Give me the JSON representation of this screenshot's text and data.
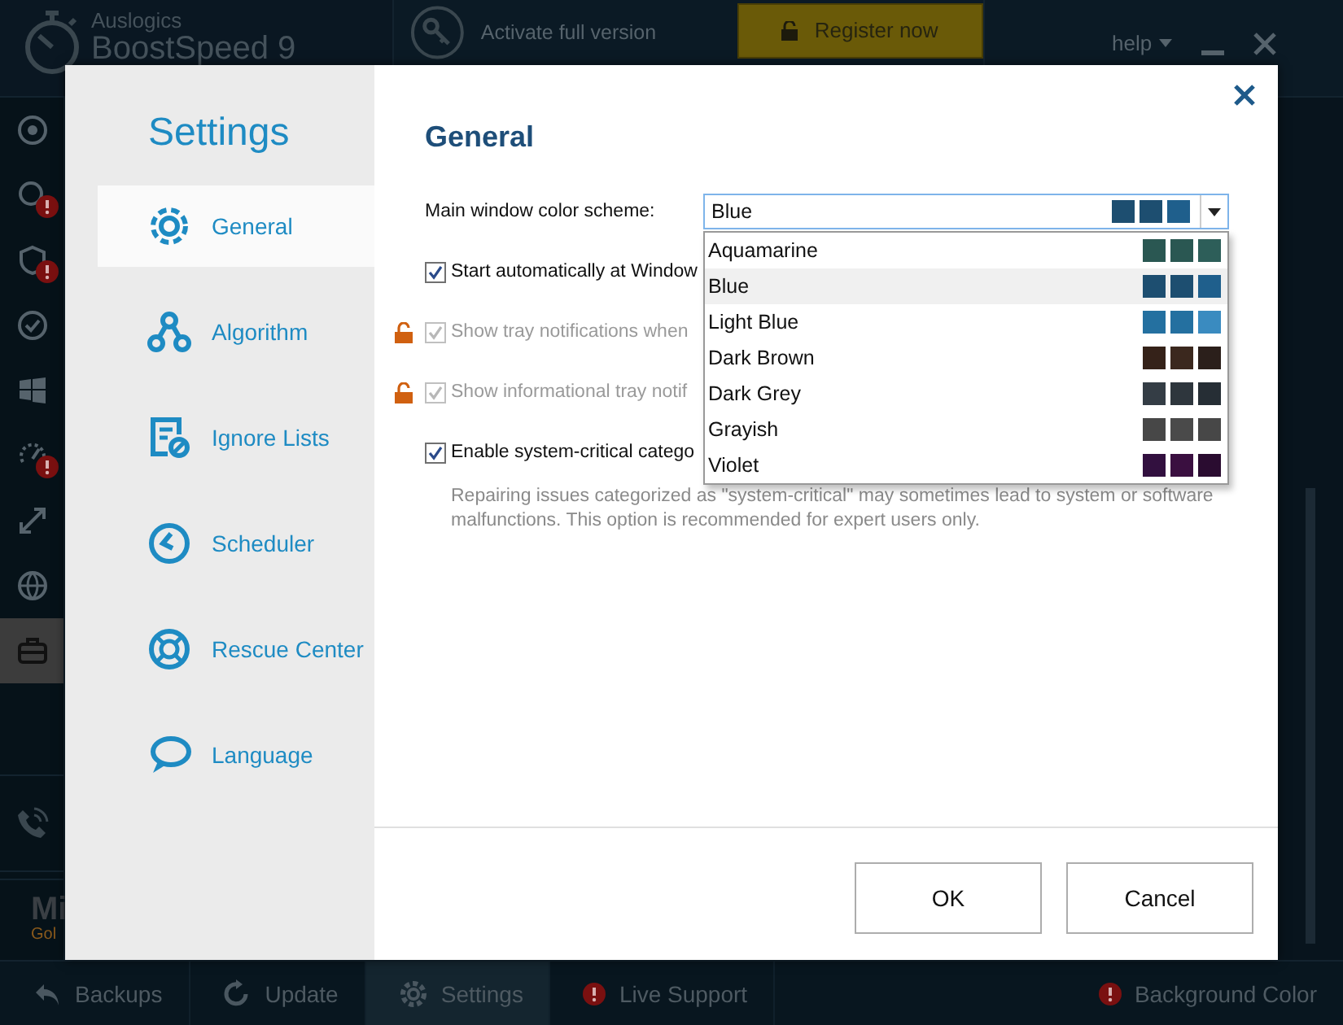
{
  "app": {
    "brand": "Auslogics",
    "product": "BoostSpeed 9",
    "activate": "Activate full version",
    "register": "Register now",
    "help": "help"
  },
  "left_bar": {
    "items": [
      {
        "alert": false,
        "selected": false
      },
      {
        "alert": true,
        "selected": false
      },
      {
        "alert": true,
        "selected": false
      },
      {
        "alert": false,
        "selected": false
      },
      {
        "alert": false,
        "selected": false
      },
      {
        "alert": true,
        "selected": false
      },
      {
        "alert": false,
        "selected": false
      },
      {
        "alert": false,
        "selected": false
      },
      {
        "alert": false,
        "selected": true
      }
    ],
    "promo_title": "Mi",
    "promo_subtitle": "Gol"
  },
  "bottom_bar": {
    "items": [
      {
        "label": "Backups",
        "selected": false,
        "alert": false
      },
      {
        "label": "Update",
        "selected": false,
        "alert": false
      },
      {
        "label": "Settings",
        "selected": true,
        "alert": false
      },
      {
        "label": "Live Support",
        "selected": false,
        "alert": true
      }
    ],
    "right_item": {
      "label": "Background Color",
      "alert": true
    }
  },
  "dialog": {
    "title": "Settings",
    "sidebar": [
      {
        "label": "General",
        "selected": true
      },
      {
        "label": "Algorithm",
        "selected": false
      },
      {
        "label": "Ignore Lists",
        "selected": false
      },
      {
        "label": "Scheduler",
        "selected": false
      },
      {
        "label": "Rescue Center",
        "selected": false
      },
      {
        "label": "Language",
        "selected": false
      }
    ],
    "heading": "General",
    "scheme": {
      "label": "Main window color scheme:",
      "value": "Blue",
      "swatches": [
        {
          "color": "#1d4e70"
        },
        {
          "color": "#1d4e70"
        },
        {
          "color": "#1f5f8c"
        }
      ],
      "expanded": true,
      "options": [
        {
          "label": "Aquamarine",
          "selected": false,
          "swatches": [
            {
              "color": "#2a5752"
            },
            {
              "color": "#2a5752"
            },
            {
              "color": "#2d5e59"
            }
          ]
        },
        {
          "label": "Blue",
          "selected": true,
          "swatches": [
            {
              "color": "#1d4e70"
            },
            {
              "color": "#1d4e70"
            },
            {
              "color": "#1f5f8c"
            }
          ]
        },
        {
          "label": "Light Blue",
          "selected": false,
          "swatches": [
            {
              "color": "#2470a0"
            },
            {
              "color": "#2470a0"
            },
            {
              "color": "#3a8bc0"
            }
          ]
        },
        {
          "label": "Dark Brown",
          "selected": false,
          "swatches": [
            {
              "color": "#352219"
            },
            {
              "color": "#3b281e"
            },
            {
              "color": "#2b1f1b"
            }
          ]
        },
        {
          "label": "Dark Grey",
          "selected": false,
          "swatches": [
            {
              "color": "#343d45"
            },
            {
              "color": "#2e363d"
            },
            {
              "color": "#262e35"
            }
          ]
        },
        {
          "label": "Grayish",
          "selected": false,
          "swatches": [
            {
              "color": "#474747"
            },
            {
              "color": "#4a4a4a"
            },
            {
              "color": "#474747"
            }
          ]
        },
        {
          "label": "Violet",
          "selected": false,
          "swatches": [
            {
              "color": "#32103f"
            },
            {
              "color": "#3a0f40"
            },
            {
              "color": "#2a0c30"
            }
          ]
        }
      ]
    },
    "options": [
      {
        "label": "Start automatically at Window",
        "checked": true,
        "disabled": false,
        "locked": false
      },
      {
        "label": "Show tray notifications when",
        "checked": true,
        "disabled": true,
        "locked": true
      },
      {
        "label": "Show informational tray notif",
        "checked": true,
        "disabled": true,
        "locked": true
      },
      {
        "label": "Enable system-critical catego",
        "checked": true,
        "disabled": false,
        "locked": false,
        "description": "Repairing issues categorized as \"system-critical\" may sometimes lead to system or software malfunctions. This option is recommended for expert users only."
      }
    ],
    "buttons": [
      "OK",
      "Cancel"
    ]
  }
}
